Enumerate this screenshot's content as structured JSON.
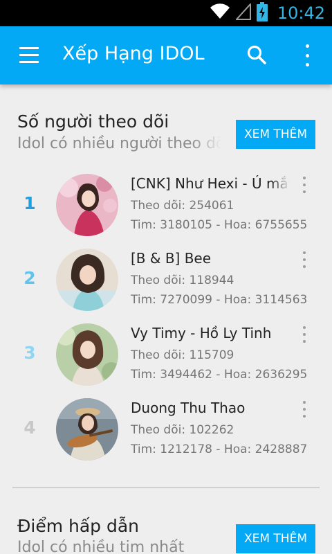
{
  "status_bar": {
    "time": "10:42",
    "icons": [
      "wifi-icon",
      "signal-icon",
      "battery-charging-icon"
    ]
  },
  "app_bar": {
    "title": "Xếp Hạng IDOL",
    "icons": [
      "menu-icon",
      "search-icon",
      "more-vert-icon"
    ]
  },
  "colors": {
    "accent": "#03a9f4",
    "status_clock": "#33b5e5",
    "rank_1": "#1e9fe3",
    "rank_2": "#5ec4ef",
    "rank_3": "#8fd6f4",
    "rank_4": "#c8c8c8"
  },
  "sections": [
    {
      "title": "Số người theo dõi",
      "subtitle": "Idol có nhiều người theo dõi",
      "button": "XEM THÊM",
      "items": [
        {
          "rank": "1",
          "name": "[CNK] Như Hexi - Ú mắt Hexi",
          "followers": "Theo dõi: 254061",
          "hearts": "Tim: 3180105 - Hoa: 6755655"
        },
        {
          "rank": "2",
          "name": "[B & B] Bee",
          "followers": "Theo dõi: 118944",
          "hearts": "Tim: 7270099 - Hoa: 3114563"
        },
        {
          "rank": "3",
          "name": "Vy Timy - Hồ Ly Tinh",
          "followers": "Theo dõi: 115709",
          "hearts": "Tim: 3494462 - Hoa: 2636295"
        },
        {
          "rank": "4",
          "name": "Duong Thu Thao",
          "followers": "Theo dõi: 102262",
          "hearts": "Tim: 1212178 - Hoa: 2428887"
        }
      ]
    },
    {
      "title": "Điểm hấp dẫn",
      "subtitle": "Idol có nhiều tim nhất",
      "button": "XEM THÊM"
    }
  ]
}
